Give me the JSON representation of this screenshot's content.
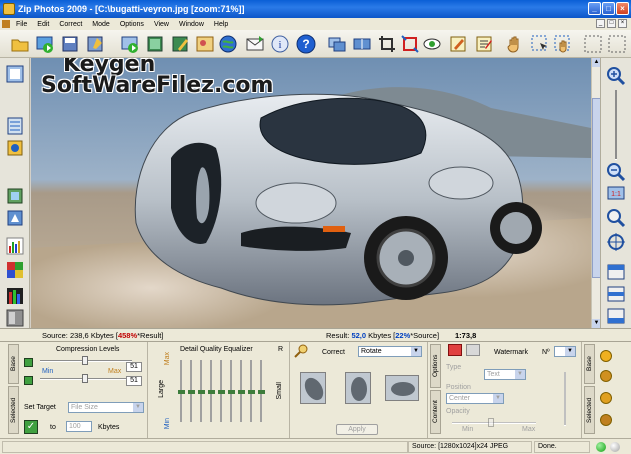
{
  "window": {
    "title": "Zip Photos 2009 - [C:\\bugatti-veyron.jpg  [zoom:71%]]",
    "minimize": "_",
    "maximize": "□",
    "close": "×"
  },
  "menu": {
    "items": [
      "File",
      "Edit",
      "Correct",
      "Mode",
      "Options",
      "View",
      "Window",
      "Help"
    ],
    "mdi_min": "_",
    "mdi_restore": "□",
    "mdi_close": "×"
  },
  "watermark": {
    "line1": "Keygen",
    "line2": "SoftWareFilez.com"
  },
  "info": {
    "source_label": "Source:",
    "source_size": "238,6",
    "source_unit": "Kbytes",
    "source_pct": "458%",
    "source_suffix": "*Result]",
    "result_label": "Result:",
    "result_size": "52,0",
    "result_unit": "Kbytes",
    "result_pct": "22%",
    "result_suffix": "*Source]",
    "ratio": "1:73,8"
  },
  "bottom": {
    "tab_selected": "Selected",
    "tab_base": "Base",
    "compression_title": "Compression Levels",
    "min_label": "Min",
    "max_label": "Max",
    "compression_value1": "51",
    "compression_value2": "51",
    "set_target_label": "Set Target",
    "set_target_select": "File Size",
    "to_label": "to",
    "to_value": "100",
    "to_unit": "Kbytes",
    "eq_title": "Detail Quality Equalizer",
    "eq_large": "Large",
    "eq_small": "Small",
    "eq_r": "R",
    "eq_max": "Max",
    "eq_min": "Min",
    "correct_label": "Correct",
    "correct_select": "Rotate",
    "apply_button": "Apply",
    "tab_options": "Options",
    "tab_content": "Content",
    "watermark_title": "Watermark",
    "watermark_no": "Nº",
    "type_label": "Type",
    "type_value": "Text",
    "position_label": "Position",
    "position_value": "Center",
    "opacity_label": "Opacity",
    "opacity_min": "Min",
    "opacity_max": "Max",
    "tab_selected2": "Selected",
    "tab_base2": "Base"
  },
  "status": {
    "source": "Source: [1280x1024]x24 JPEG",
    "state": "Done."
  },
  "colors": {
    "titlebar": "#0a5fd6",
    "accent_red": "#c00000",
    "accent_blue": "#0040c0"
  }
}
